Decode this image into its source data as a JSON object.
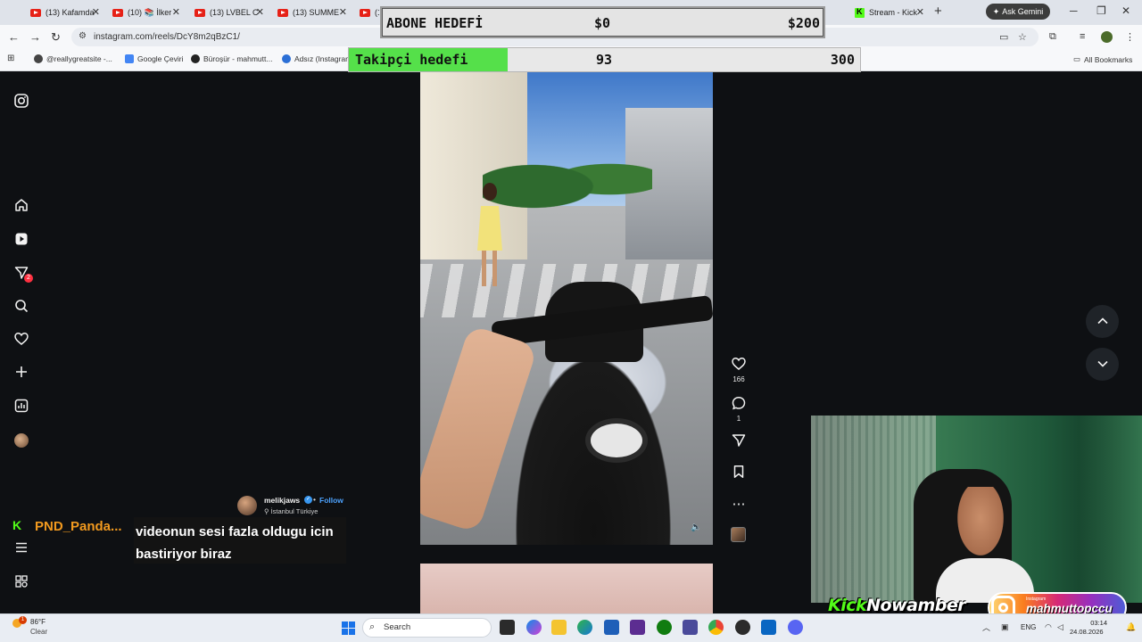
{
  "browser": {
    "tabs": [
      {
        "label": "(13) Kafamda",
        "type": "youtube"
      },
      {
        "label": "(10) 📚 İlker",
        "type": "youtube"
      },
      {
        "label": "(13) LVBEL C",
        "type": "youtube"
      },
      {
        "label": "(13) SUMME",
        "type": "youtube"
      },
      {
        "label": "(1",
        "type": "youtube"
      },
      {
        "label": "Stream - Kick",
        "type": "kick"
      }
    ],
    "new_tab": "+",
    "gemini_label": "Ask Gemini",
    "url": "instagram.com/reels/DcY8m2qBzC1/",
    "bookmarks": [
      "@reallygreatsite -...",
      "Google Çeviri",
      "Büroşür - mahmutt...",
      "Adsız (Instagram"
    ],
    "all_bookmarks": "All Bookmarks"
  },
  "overlay": {
    "abone": {
      "label": "ABONE HEDEFİ",
      "current": "$0",
      "goal": "$200"
    },
    "takipci": {
      "label": "Takipçi hedefi",
      "current": "93",
      "goal": "300",
      "progress": 0.31
    }
  },
  "instagram": {
    "sidebar_icons": [
      "instagram-logo-icon",
      "home-icon",
      "reels-icon",
      "messages-icon",
      "search-icon",
      "heart-icon",
      "create-icon",
      "dashboard-icon",
      "profile-icon",
      "menu-icon",
      "more-icon"
    ],
    "notification_count": "2",
    "likes": "166",
    "comments": "1",
    "author": {
      "username": "melikjaws",
      "follow_sep": "•",
      "follow": "Follow",
      "location": "İstanbul Türkiye"
    }
  },
  "chat": {
    "username": "PND_Panda...",
    "message": "videonun sesi fazla oldugu icin bastiriyor biraz"
  },
  "branding": {
    "kick_text": "Kick",
    "kick_suffix": "Nowamber",
    "insta_small": "Instagram",
    "insta_handle": "mahmuttopccu"
  },
  "taskbar": {
    "weather_temp": "86°F",
    "weather_desc": "Clear",
    "weather_badge": "1",
    "search_placeholder": "Search",
    "language": "ENG",
    "time": "03:14",
    "date": "24.08.2026"
  },
  "colors": {
    "kick_green": "#53fc18",
    "chat_orange": "#f29a1f",
    "follow_blue": "#4da3ff"
  }
}
